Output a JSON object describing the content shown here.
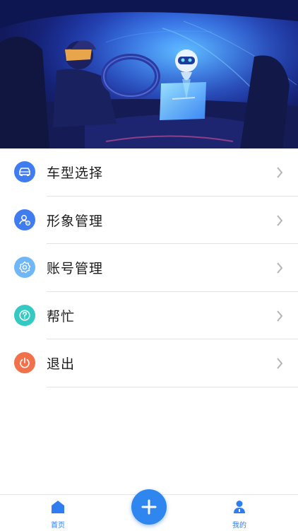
{
  "menu": {
    "items": [
      {
        "label": "车型选择",
        "icon": "car-icon",
        "color": "#3f7cf0"
      },
      {
        "label": "形象管理",
        "icon": "avatar-settings-icon",
        "color": "#3f7cf0"
      },
      {
        "label": "账号管理",
        "icon": "gear-icon",
        "color": "#6fb7f7"
      },
      {
        "label": "帮忙",
        "icon": "help-icon",
        "color": "#35c9c4"
      },
      {
        "label": "退出",
        "icon": "power-icon",
        "color": "#f0714a"
      }
    ]
  },
  "tabbar": {
    "home_label": "首页",
    "add_icon": "plus-icon",
    "mine_label": "我的",
    "accent": "#2f86ef"
  }
}
